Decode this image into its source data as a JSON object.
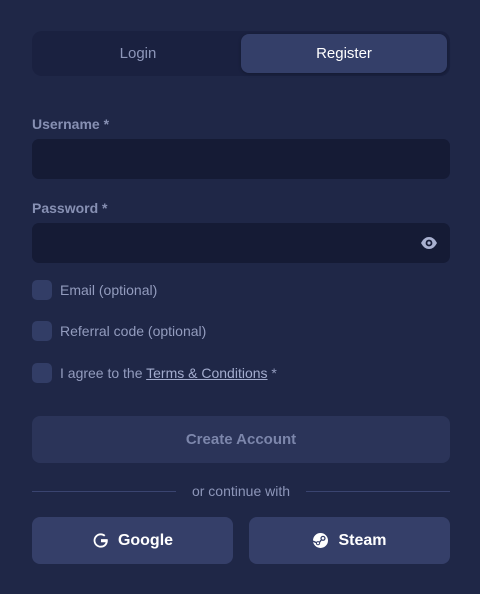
{
  "tabs": {
    "login": "Login",
    "register": "Register",
    "active": "register"
  },
  "form": {
    "username_label": "Username *",
    "username_value": "",
    "password_label": "Password *",
    "password_value": "",
    "email_label": "Email (optional)",
    "referral_label": "Referral code (optional)",
    "agree_prefix": "I agree to the ",
    "terms_link": "Terms & Conditions",
    "agree_suffix": " *"
  },
  "actions": {
    "create_account": "Create Account"
  },
  "divider": {
    "text": "or continue with"
  },
  "social": {
    "google": "Google",
    "steam": "Steam"
  },
  "icons": {
    "password_toggle": "eye-icon",
    "google": "google-icon",
    "steam": "steam-icon"
  },
  "colors": {
    "background": "#1f2747",
    "tab_active": "#343f69",
    "input_bg": "#151b35",
    "button_bg": "#353f69"
  }
}
